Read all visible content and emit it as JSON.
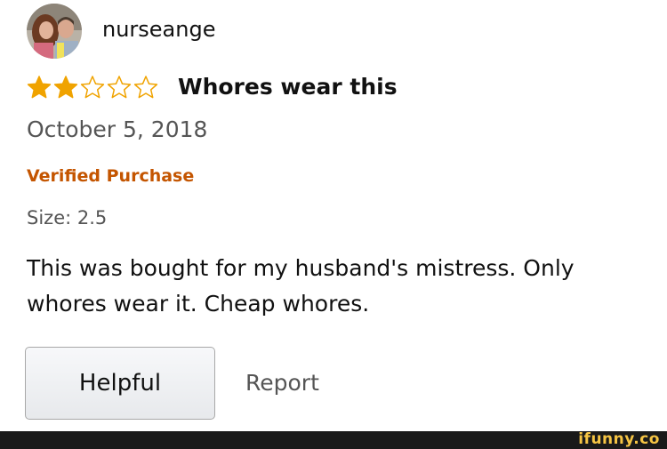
{
  "review": {
    "username": "nurseange",
    "avatar_icon": "profile-photo",
    "rating": 2,
    "rating_max": 5,
    "star_color": "#f0a300",
    "title": "Whores wear this",
    "date": "October 5, 2018",
    "verified_label": "Verified Purchase",
    "verified_color": "#c45500",
    "size_label": "Size: 2.5",
    "body": "This was bought for my husband's mistress. Only whores wear it. Cheap whores.",
    "helpful_label": "Helpful",
    "report_label": "Report"
  },
  "watermark": {
    "text": "ifunny.co"
  }
}
